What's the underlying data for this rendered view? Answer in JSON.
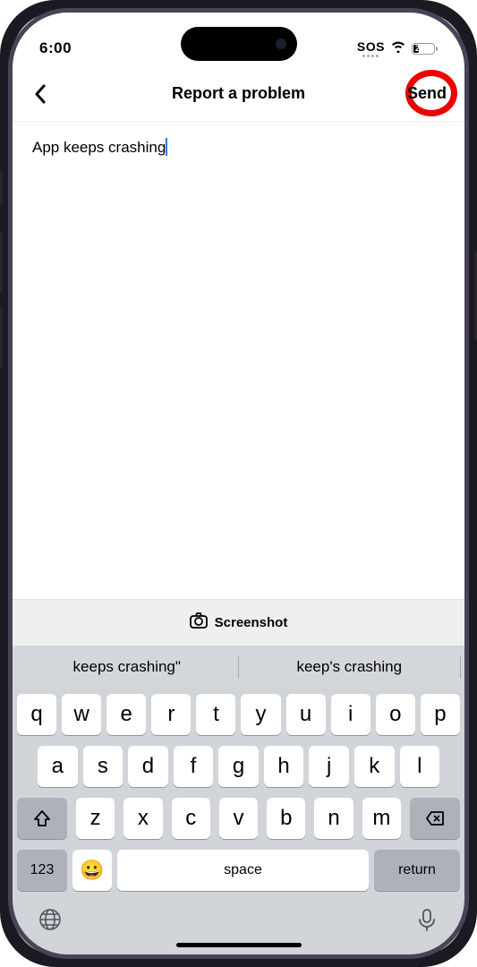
{
  "status": {
    "time": "6:00",
    "sos": "SOS",
    "battery": "27"
  },
  "nav": {
    "title": "Report a problem",
    "send": "Send"
  },
  "content": {
    "text": "App keeps crashing"
  },
  "toolbar": {
    "screenshot": "Screenshot"
  },
  "keyboard": {
    "suggestions": [
      "keeps crashing\"",
      "keep's crashing"
    ],
    "row1": [
      "q",
      "w",
      "e",
      "r",
      "t",
      "y",
      "u",
      "i",
      "o",
      "p"
    ],
    "row2": [
      "a",
      "s",
      "d",
      "f",
      "g",
      "h",
      "j",
      "k",
      "l"
    ],
    "row3": [
      "z",
      "x",
      "c",
      "v",
      "b",
      "n",
      "m"
    ],
    "numKey": "123",
    "space": "space",
    "return": "return"
  }
}
